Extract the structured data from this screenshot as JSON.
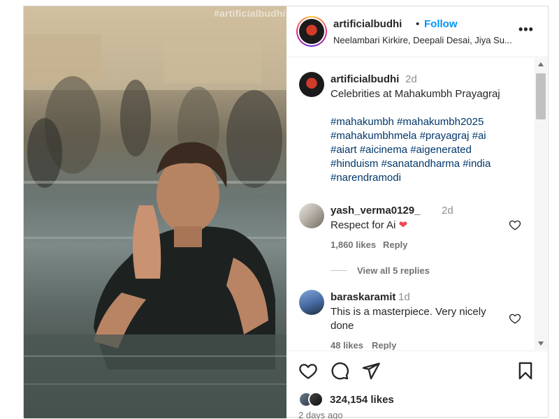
{
  "media": {
    "watermark": "#artificialbudhi"
  },
  "header": {
    "username": "artificialbudhi",
    "separator": "•",
    "follow_label": "Follow",
    "subtitle": "Neelambari Kirkire, Deepali Desai, Jiya Su...",
    "more_label": "•••"
  },
  "caption": {
    "username": "artificialbudhi",
    "time": "2d",
    "text": "Celebrities at Mahakumbh Prayagraj",
    "hashtags_lines": [
      "#mahakumbh #mahakumbh2025",
      "#mahakumbhmela #prayagraj #ai",
      "#aiart #aicinema #aigenerated",
      "#hinduism #sanatandharma #india",
      "#narendramodi"
    ]
  },
  "comments": [
    {
      "username": "yash_verma0129_",
      "time": "2d",
      "text": "Respect for Ai",
      "emoji": "❤",
      "likes": "1,860 likes",
      "reply_label": "Reply"
    },
    {
      "username": "baraskaramit",
      "time": "1d",
      "text_line1": "This is a masterpiece. Very nicely",
      "text_line2": "done",
      "likes": "48 likes",
      "reply_label": "Reply"
    }
  ],
  "view_replies": "View all 5 replies",
  "footer": {
    "likes": "324,154 likes",
    "posted": "2 days ago"
  },
  "colors": {
    "follow": "#0095f6",
    "hashtag": "#00376b",
    "heart_emoji": "#ed4956"
  }
}
